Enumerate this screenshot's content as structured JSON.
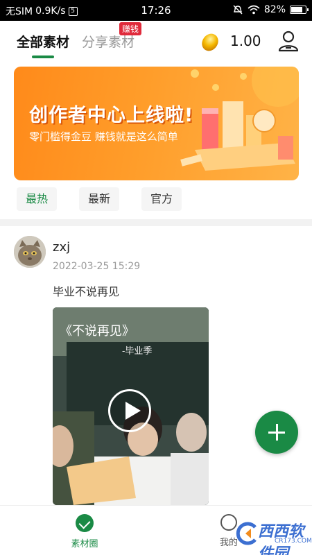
{
  "status_bar": {
    "carrier": "无SIM",
    "speed": "0.9K/s",
    "sim_badge": "5",
    "time": "17:26",
    "battery": "82%",
    "battery_level": 0.82
  },
  "header": {
    "tabs": [
      {
        "label": "全部素材",
        "active": true
      },
      {
        "label": "分享素材",
        "active": false,
        "badge": "赚钱"
      }
    ],
    "bean_balance": "1.00"
  },
  "banner": {
    "title": "创作者中心上线啦!",
    "subtitle": "零门槛得金豆 赚钱就是这么简单"
  },
  "filters": [
    {
      "label": "最热",
      "active": true
    },
    {
      "label": "最新",
      "active": false
    },
    {
      "label": "官方",
      "active": false
    }
  ],
  "post": {
    "username": "zxj",
    "timestamp": "2022-03-25 15:29",
    "text": "毕业不说再见",
    "video_title": "《不说再见》",
    "video_caption": "-毕业季"
  },
  "bottom_nav": {
    "items": [
      {
        "label": "素材圈",
        "active": true
      },
      {
        "label": "我的",
        "active": false
      }
    ]
  },
  "watermark": {
    "text": "西西软件园",
    "sub": "CR173.COM"
  },
  "colors": {
    "accent": "#1a8a45",
    "badge": "#e02a3b",
    "banner": "#ff9d2a"
  }
}
